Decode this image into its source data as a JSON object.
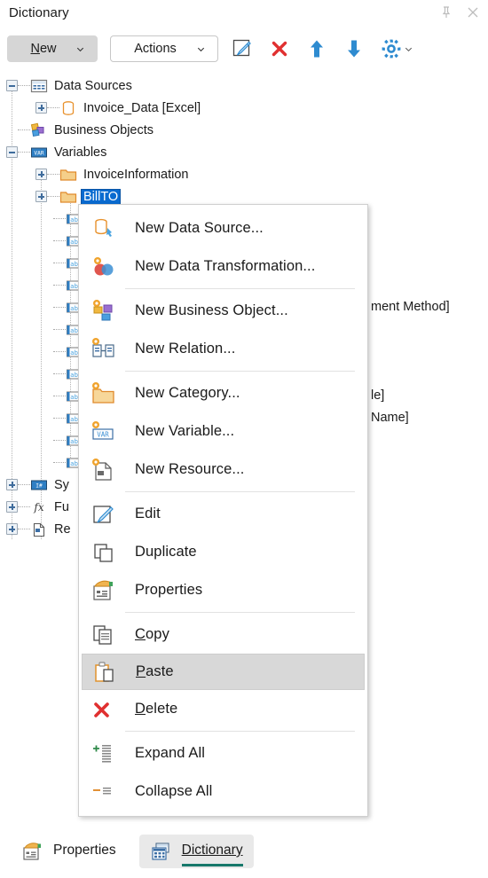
{
  "panel": {
    "title": "Dictionary",
    "pin_icon": "pin-icon",
    "close_icon": "close-icon"
  },
  "toolbar": {
    "new_label_accel": "N",
    "new_label_rest": "ew",
    "actions_label": "Actions",
    "icons": [
      {
        "name": "edit-icon",
        "title": "Edit"
      },
      {
        "name": "delete-icon",
        "title": "Delete"
      },
      {
        "name": "move-up-icon",
        "title": "Move Up"
      },
      {
        "name": "move-down-icon",
        "title": "Move Down"
      },
      {
        "name": "settings-gear-icon",
        "title": "Settings"
      }
    ]
  },
  "tree": {
    "nodes": [
      {
        "label": "Data Sources",
        "icon": "data-sources-icon",
        "indent": 0,
        "expander": "minus",
        "selected": false
      },
      {
        "label": "Invoice_Data [Excel]",
        "icon": "database-icon",
        "indent": 1,
        "expander": "plus",
        "selected": false
      },
      {
        "label": "Business Objects",
        "icon": "business-objects-icon",
        "indent": 0,
        "expander": "none",
        "selected": false
      },
      {
        "label": "Variables",
        "icon": "variables-icon",
        "indent": 0,
        "expander": "minus",
        "selected": false
      },
      {
        "label": "InvoiceInformation",
        "icon": "folder-icon",
        "indent": 1,
        "expander": "plus",
        "selected": false
      },
      {
        "label": "BillTO",
        "icon": "folder-icon",
        "indent": 1,
        "expander": "plus",
        "selected": true
      }
    ],
    "variable_items": [
      {
        "icon": "abc-variable-icon"
      },
      {
        "icon": "abc-variable-icon"
      },
      {
        "icon": "abc-variable-icon"
      },
      {
        "icon": "abc-variable-icon"
      },
      {
        "icon": "abc-variable-icon"
      },
      {
        "icon": "abc-variable-icon"
      },
      {
        "icon": "abc-variable-icon"
      },
      {
        "icon": "abc-variable-icon"
      },
      {
        "icon": "abc-variable-icon"
      },
      {
        "icon": "abc-variable-icon"
      },
      {
        "icon": "abc-variable-icon"
      },
      {
        "icon": "abc-variable-icon"
      }
    ],
    "bottom_nodes": [
      {
        "label": "Sy",
        "icon": "system-variables-icon",
        "expander": "plus"
      },
      {
        "label": "Fu",
        "icon": "functions-icon",
        "expander": "plus"
      },
      {
        "label": "Re",
        "icon": "resources-icon",
        "expander": "plus"
      }
    ],
    "occluded_text_fragments": [
      {
        "text": "ment Method]"
      },
      {
        "text": "le]"
      },
      {
        "text": "Name]"
      }
    ]
  },
  "context_menu": {
    "items": [
      {
        "label": "New Data Source...",
        "icon": "new-data-source-icon",
        "accel": "",
        "highlighted": false,
        "sep_after": false
      },
      {
        "label": "New Data Transformation...",
        "icon": "new-data-transformation-icon",
        "accel": "",
        "highlighted": false,
        "sep_after": true
      },
      {
        "label": "New Business Object...",
        "icon": "new-business-object-icon",
        "accel": "",
        "highlighted": false,
        "sep_after": false
      },
      {
        "label": "New Relation...",
        "icon": "new-relation-icon",
        "accel": "",
        "highlighted": false,
        "sep_after": true
      },
      {
        "label": "New Category...",
        "icon": "new-category-icon",
        "accel": "",
        "highlighted": false,
        "sep_after": false
      },
      {
        "label": "New Variable...",
        "icon": "new-variable-icon",
        "accel": "",
        "highlighted": false,
        "sep_after": false
      },
      {
        "label": "New Resource...",
        "icon": "new-resource-icon",
        "accel": "",
        "highlighted": false,
        "sep_after": true
      },
      {
        "label": "Edit",
        "icon": "edit-icon",
        "accel": "",
        "highlighted": false,
        "sep_after": false
      },
      {
        "label": "Duplicate",
        "icon": "duplicate-icon",
        "accel": "",
        "highlighted": false,
        "sep_after": false
      },
      {
        "label": "Properties",
        "icon": "properties-icon",
        "accel": "",
        "highlighted": false,
        "sep_after": true
      },
      {
        "label": "Copy",
        "icon": "copy-icon",
        "accel": "C",
        "highlighted": false,
        "sep_after": false
      },
      {
        "label": "Paste",
        "icon": "paste-icon",
        "accel": "P",
        "highlighted": true,
        "sep_after": false
      },
      {
        "label": "Delete",
        "icon": "delete-icon",
        "accel": "D",
        "highlighted": false,
        "sep_after": true
      },
      {
        "label": "Expand All",
        "icon": "expand-all-icon",
        "accel": "",
        "highlighted": false,
        "sep_after": false
      },
      {
        "label": "Collapse All",
        "icon": "collapse-all-icon",
        "accel": "",
        "highlighted": false,
        "sep_after": false
      }
    ]
  },
  "bottom_tabs": [
    {
      "label": "Properties",
      "icon": "properties-icon",
      "active": false
    },
    {
      "label": "Dictionary",
      "icon": "dictionary-icon",
      "active": true
    }
  ],
  "colors": {
    "selection_blue": "#0a6bd0",
    "accent_teal": "#17786b",
    "delete_red": "#e03030",
    "arrow_blue": "#2e8bd0",
    "folder_orange": "#e8a33d",
    "menu_highlight": "#d8d8d8"
  }
}
